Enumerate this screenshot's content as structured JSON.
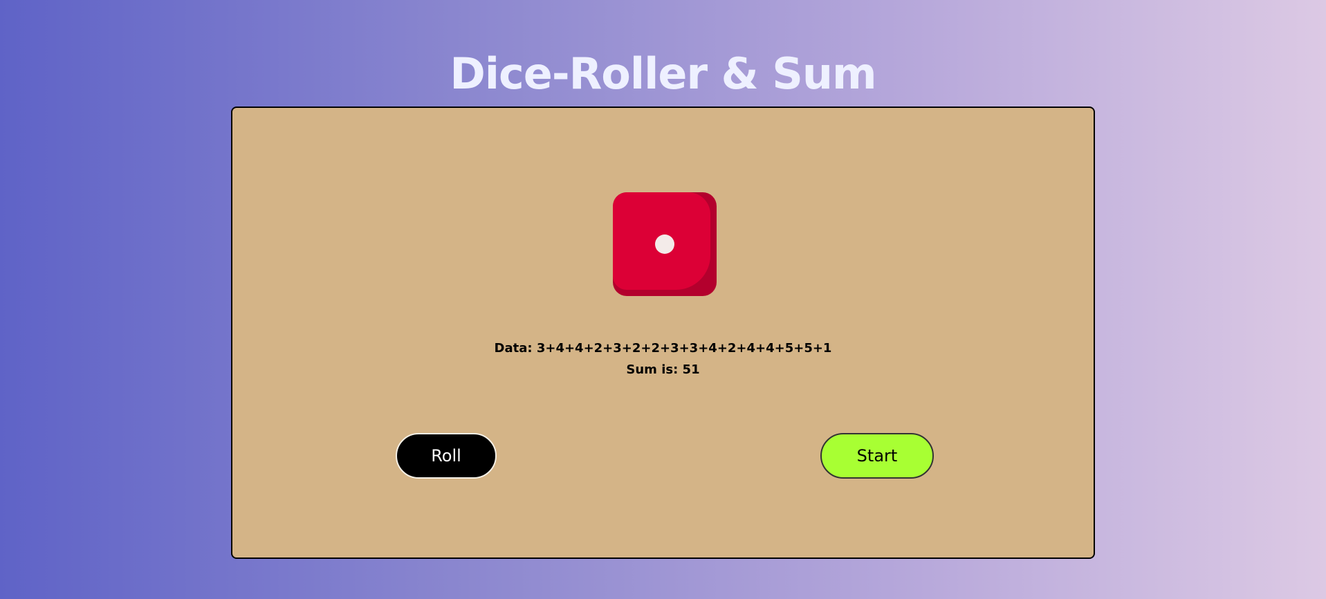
{
  "page": {
    "title": "Dice-Roller & Sum"
  },
  "die": {
    "value": 1,
    "color": "#dc0036",
    "shadow_color": "#b3002d",
    "pip_color": "#f3ebe9"
  },
  "results": {
    "data_text": "Data: 3+4+4+2+3+2+2+3+3+4+2+4+4+5+5+1",
    "sum_text": "Sum is: 51"
  },
  "buttons": {
    "roll_label": "Roll",
    "start_label": "Start"
  },
  "colors": {
    "card_background": "#d4b487",
    "start_button": "#a8ff33",
    "roll_button": "#000000",
    "title_text": "#eef0ff"
  }
}
